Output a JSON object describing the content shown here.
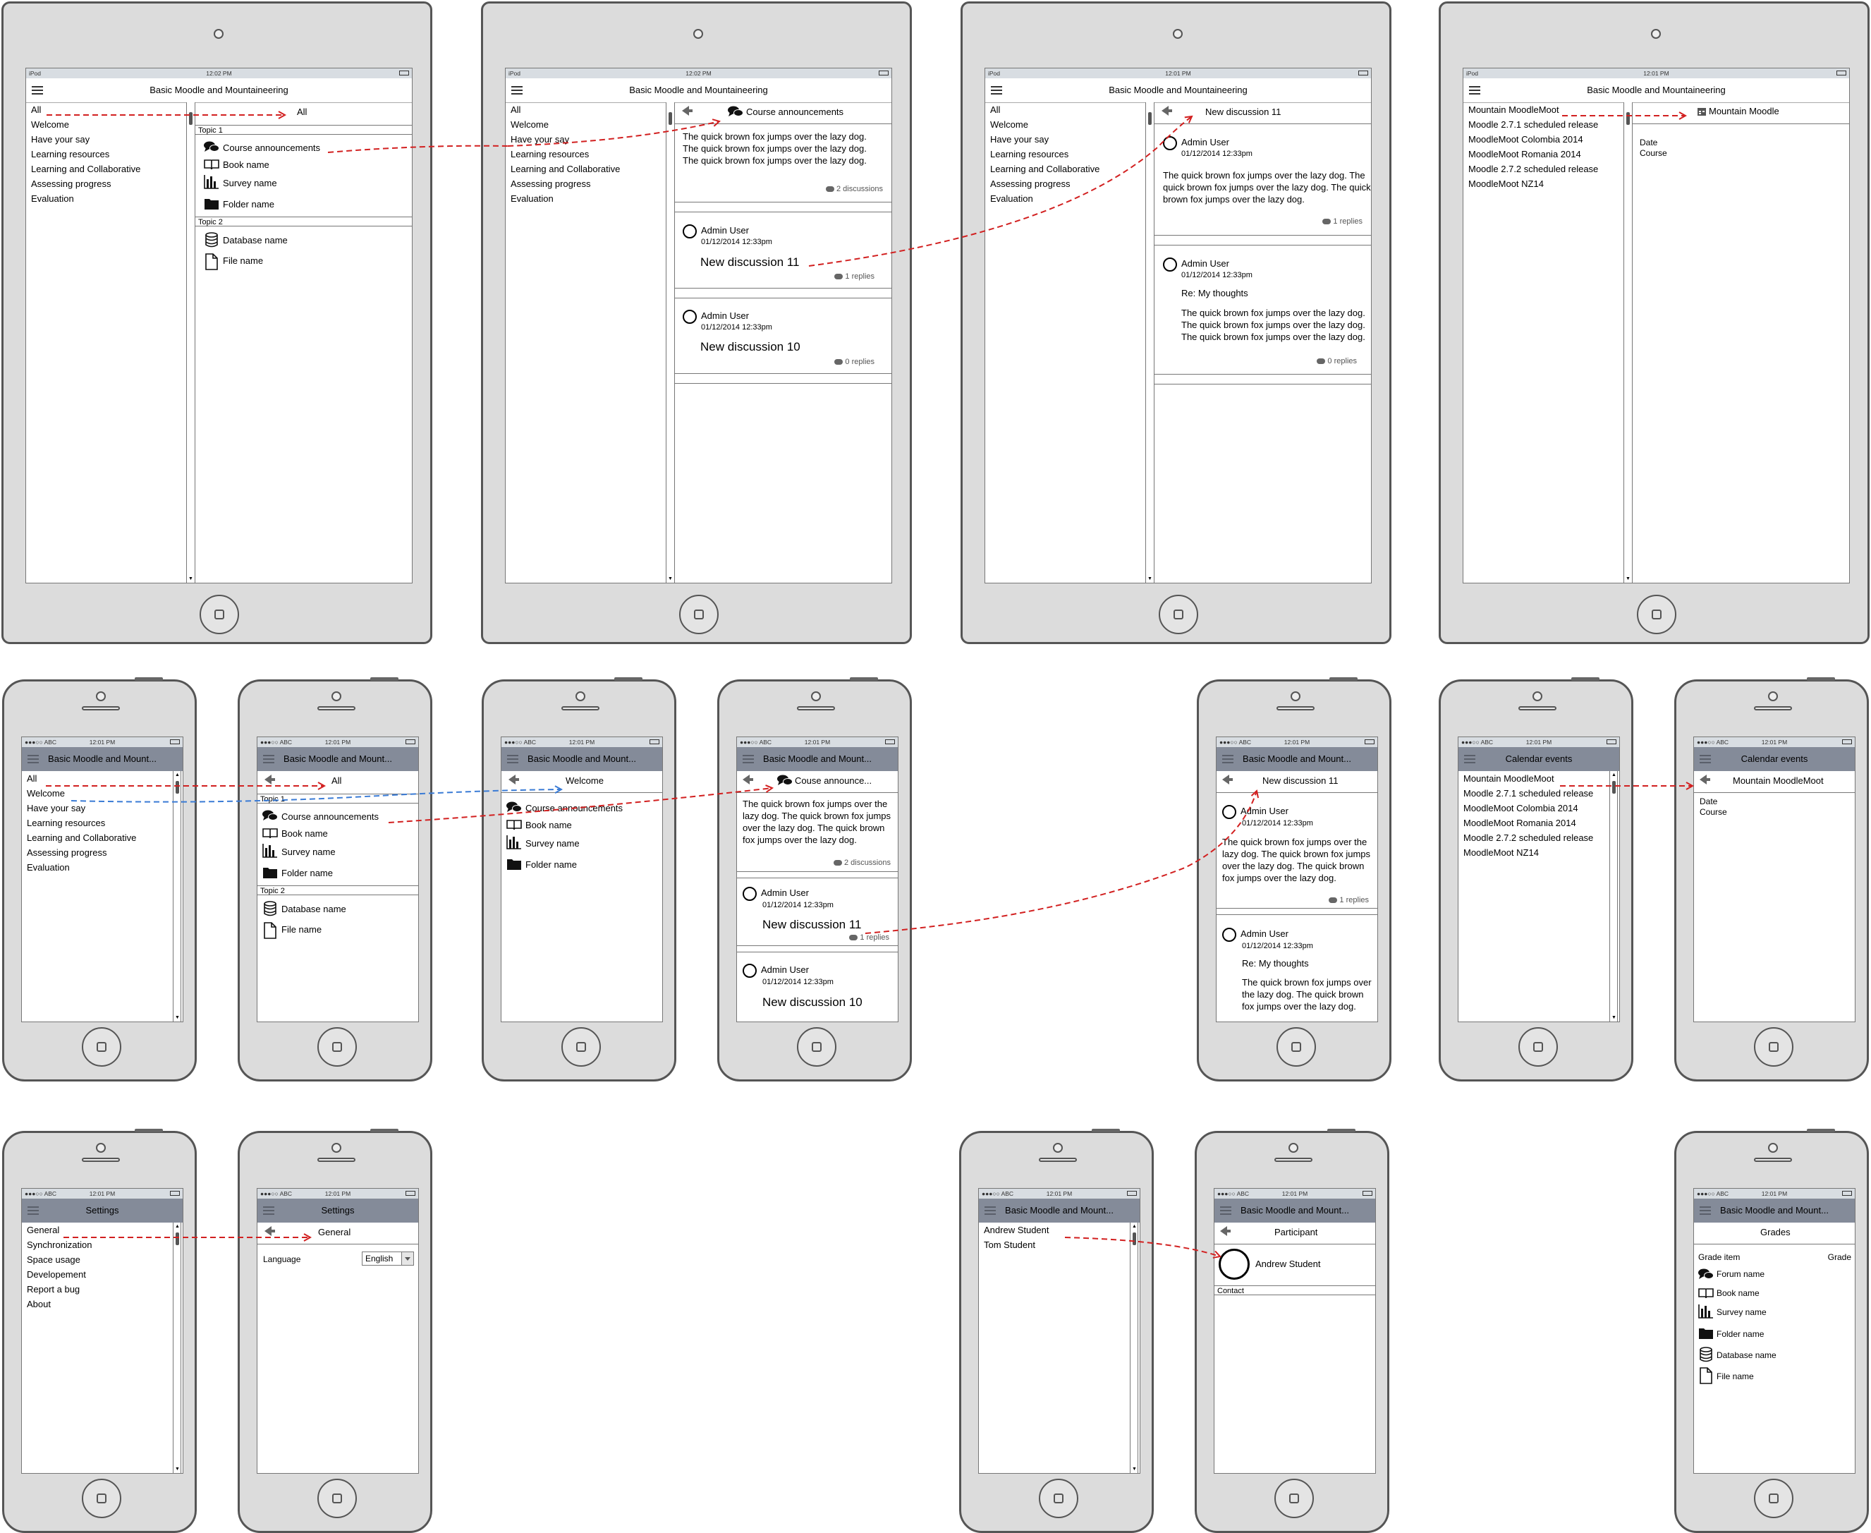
{
  "course_title": "Basic Moodle and Mountaineering",
  "course_title_short": "Basic Moodle and Mount...",
  "status": {
    "ipad_carrier": "iPod",
    "iphone_carrier": "●●●○○ ABC",
    "time_a": "12:02 PM",
    "time_b": "12:01 PM"
  },
  "sections": [
    "All",
    "Welcome",
    "Have your say",
    "Learning resources",
    "Learning and Collaborative",
    "Assessing progress",
    "Evaluation"
  ],
  "all_header": "All",
  "welcome_header": "Welcome",
  "topic1": "Topic 1",
  "topic2": "Topic 2",
  "modules": {
    "forum": "Course announcements",
    "forum_short": "Couse announce...",
    "book": "Book name",
    "survey": "Survey name",
    "folder": "Folder name",
    "database": "Database name",
    "file": "File name"
  },
  "forum_desc": "The quick brown fox jumps over the lazy dog. The quick brown fox jumps over the lazy dog. The quick brown fox jumps over the lazy dog.",
  "discussion_count": "2 discussions",
  "admin_user": "Admin User",
  "post_date": "01/12/2014 12:33pm",
  "discussion_11": "New discussion 11",
  "discussion_10": "New discussion 10",
  "replies_1": "1 replies",
  "replies_0": "0 replies",
  "reply_subject": "Re: My thoughts",
  "post_body": "The quick brown fox jumps over the lazy dog. The quick brown fox jumps over the lazy dog. The quick brown fox jumps over the lazy dog.",
  "reply_body": "The quick brown fox jumps over the lazy dog. The quick brown fox jumps over the lazy dog.",
  "calendar_title": "Calendar events",
  "events": [
    "Mountain MoodleMoot",
    "Moodle 2.7.1 scheduled release",
    "MoodleMoot Colombia 2014",
    "MoodleMoot Romania 2014",
    "Moodle 2.7.2 scheduled release",
    "MoodleMoot NZ14"
  ],
  "event_ipad_header": "Mountain Moodle",
  "event_phone_header": "Mountain MoodleMoot",
  "event_fields": [
    "Date",
    "Course"
  ],
  "settings_title": "Settings",
  "settings_items": [
    "General",
    "Synchronization",
    "Space usage",
    "Developement",
    "Report a bug",
    "About"
  ],
  "general_header": "General",
  "language_label": "Language",
  "language_value": "English",
  "participants": [
    "Andrew Student",
    "Tom Student"
  ],
  "participant_title": "Participant",
  "participant_name": "Andrew Student",
  "contact_label": "Contact",
  "grades_title": "Grades",
  "grade_item_col": "Grade item",
  "grade_col": "Grade",
  "grade_items": {
    "forum": "Forum name",
    "book": "Book name",
    "survey": "Survey name",
    "folder": "Folder name",
    "database": "Database name",
    "file": "File name"
  },
  "colors": {
    "device": "#dcdcdc",
    "navbar_dark": "#848b99",
    "link_red": "#d22020",
    "link_blue": "#3a7bd5"
  }
}
